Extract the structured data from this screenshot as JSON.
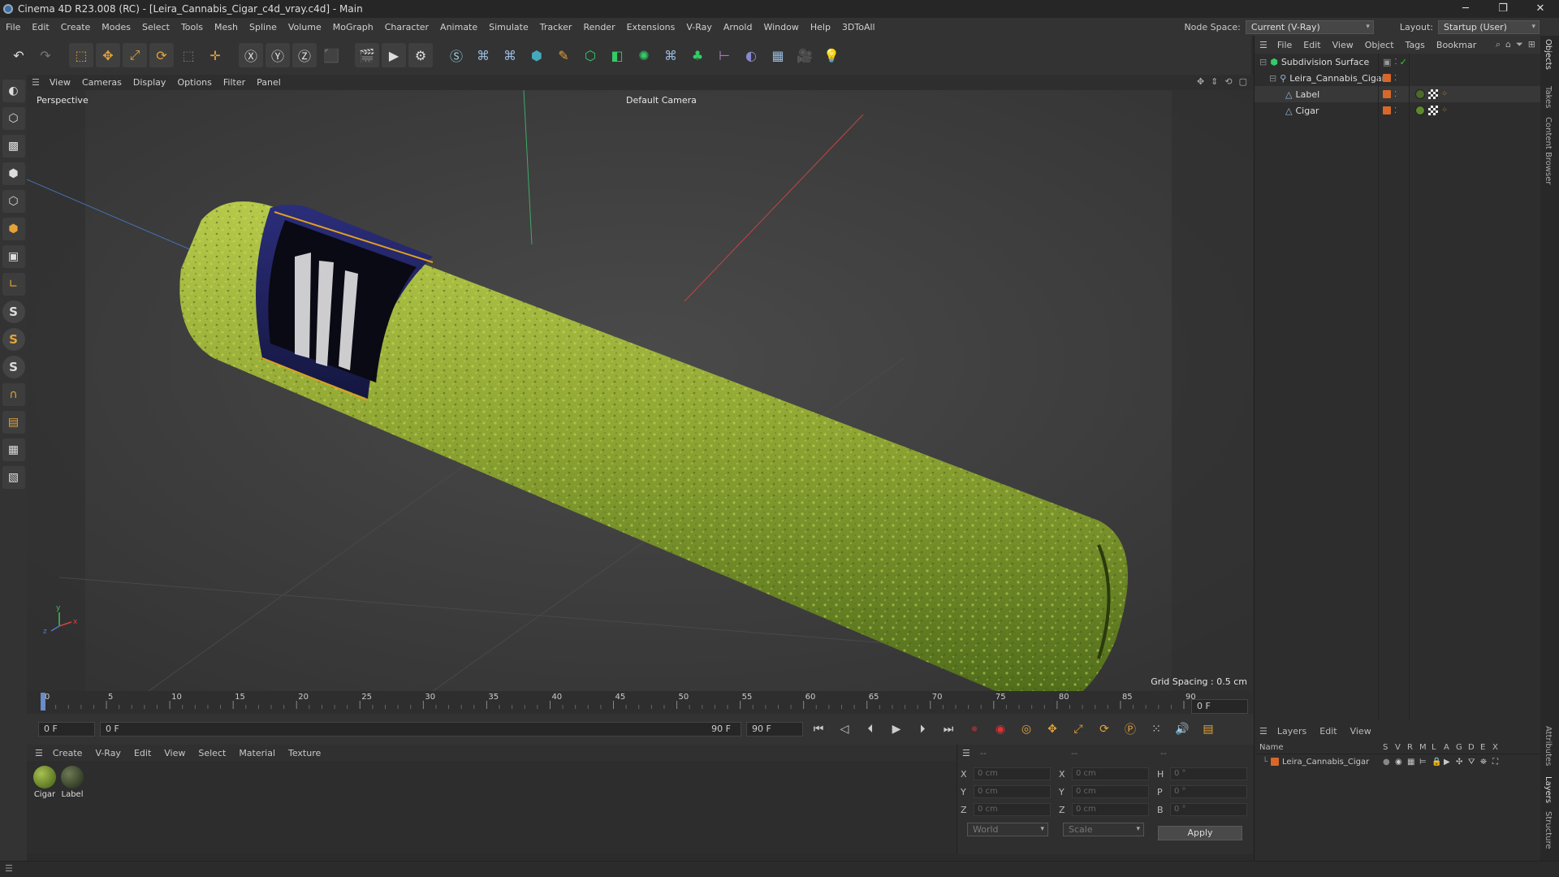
{
  "titlebar": {
    "title": "Cinema 4D R23.008 (RC) - [Leira_Cannabis_Cigar_c4d_vray.c4d] - Main",
    "minimize": "─",
    "restore": "❐",
    "close": "✕"
  },
  "menubar": {
    "items": [
      "File",
      "Edit",
      "Create",
      "Modes",
      "Select",
      "Tools",
      "Mesh",
      "Spline",
      "Volume",
      "MoGraph",
      "Character",
      "Animate",
      "Simulate",
      "Tracker",
      "Render",
      "Extensions",
      "V-Ray",
      "Arnold",
      "Window",
      "Help",
      "3DToAll"
    ],
    "node_space_label": "Node Space:",
    "node_space_value": "Current (V-Ray)",
    "layout_label": "Layout:",
    "layout_value": "Startup (User)"
  },
  "viewport_menu": {
    "items": [
      "View",
      "Cameras",
      "Display",
      "Options",
      "Filter",
      "Panel"
    ]
  },
  "viewport": {
    "view_name": "Perspective",
    "camera": "Default Camera",
    "grid_spacing": "Grid Spacing : 0.5 cm",
    "axis_labels": {
      "x": "x",
      "y": "y",
      "z": "z"
    }
  },
  "timeline": {
    "ticks": [
      "0",
      "5",
      "10",
      "15",
      "20",
      "25",
      "30",
      "35",
      "40",
      "45",
      "50",
      "55",
      "60",
      "65",
      "70",
      "75",
      "80",
      "85",
      "90"
    ],
    "current_frame": "0 F"
  },
  "transport": {
    "start": "0 F",
    "range_start": "0 F",
    "range_end": "90 F",
    "end": "90 F"
  },
  "material_menu": {
    "items": [
      "Create",
      "V-Ray",
      "Edit",
      "View",
      "Select",
      "Material",
      "Texture"
    ]
  },
  "materials": [
    {
      "name": "Cigar",
      "color": "#6f8a32"
    },
    {
      "name": "Label",
      "color": "#3d4a2a"
    }
  ],
  "coords": {
    "header": [
      "--",
      "--",
      "--"
    ],
    "rows": [
      {
        "k1": "X",
        "v1": "0 cm",
        "k2": "X",
        "v2": "0 cm",
        "k3": "H",
        "v3": "0 °"
      },
      {
        "k1": "Y",
        "v1": "0 cm",
        "k2": "Y",
        "v2": "0 cm",
        "k3": "P",
        "v3": "0 °"
      },
      {
        "k1": "Z",
        "v1": "0 cm",
        "k2": "Z",
        "v2": "0 cm",
        "k3": "B",
        "v3": "0 °"
      }
    ],
    "mode": "World",
    "scale": "Scale",
    "apply": "Apply"
  },
  "objects_menu": {
    "items": [
      "File",
      "Edit",
      "View",
      "Object",
      "Tags",
      "Bookmar"
    ]
  },
  "objects": [
    {
      "name": "Subdivision Surface",
      "level": 0
    },
    {
      "name": "Leira_Cannabis_Cigar",
      "level": 1
    },
    {
      "name": "Label",
      "level": 2
    },
    {
      "name": "Cigar",
      "level": 2
    }
  ],
  "layers_menu": {
    "items": [
      "Layers",
      "Edit",
      "View"
    ]
  },
  "layers": {
    "columns": [
      "Name",
      "S",
      "V",
      "R",
      "M",
      "L",
      "A",
      "G",
      "D",
      "E",
      "X"
    ],
    "rows": [
      {
        "name": "Leira_Cannabis_Cigar"
      }
    ]
  },
  "side_tabs": {
    "top": [
      "Objects",
      "Takes",
      "Content Browser"
    ],
    "bottom": [
      "Attributes",
      "Layers",
      "Structure"
    ]
  },
  "colors": {
    "accent": "#d8672a",
    "ui_bg": "#333333",
    "viewport_bg": "#3a3a3a"
  }
}
